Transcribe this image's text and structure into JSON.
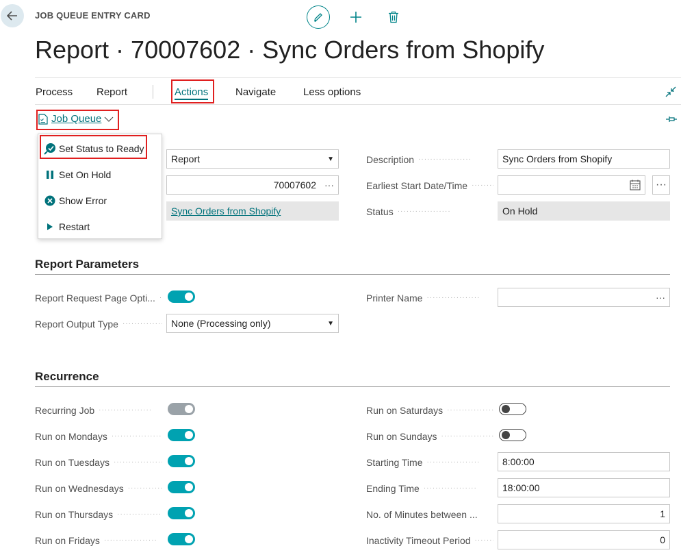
{
  "header": {
    "card_label": "JOB QUEUE ENTRY CARD",
    "title": "Report · 70007602 · Sync Orders from Shopify"
  },
  "icons": {
    "back": "arrow-left-icon",
    "edit": "pencil-icon",
    "new": "plus-icon",
    "delete": "trash-icon",
    "collapse": "collapse-arrows-icon",
    "pin": "pin-icon"
  },
  "action_bar": {
    "tabs": [
      "Process",
      "Report",
      "Actions",
      "Navigate",
      "Less options"
    ],
    "active": "Actions"
  },
  "sub_bar": {
    "group_label": "Job Queue"
  },
  "dropdown": {
    "items": [
      "Set Status to Ready",
      "Set On Hold",
      "Show Error",
      "Restart"
    ]
  },
  "general": {
    "object_type": "Report",
    "object_id": "70007602",
    "object_caption": "Sync Orders from Shopify",
    "description_label": "Description",
    "description_value": "Sync Orders from Shopify",
    "earliest_start_label": "Earliest Start Date/Time",
    "earliest_start_value": "",
    "status_label": "Status",
    "status_value": "On Hold",
    "ellipsis": "···"
  },
  "report_parameters": {
    "title": "Report Parameters",
    "request_page_label": "Report Request Page Opti...",
    "request_page_on": true,
    "output_type_label": "Report Output Type",
    "output_type_value": "None (Processing only)",
    "printer_label": "Printer Name",
    "printer_value": "",
    "ellipsis": "···"
  },
  "recurrence": {
    "title": "Recurrence",
    "left": [
      {
        "label": "Recurring Job",
        "state": "disabled"
      },
      {
        "label": "Run on Mondays",
        "state": "on"
      },
      {
        "label": "Run on Tuesdays",
        "state": "on"
      },
      {
        "label": "Run on Wednesdays",
        "state": "on"
      },
      {
        "label": "Run on Thursdays",
        "state": "on"
      },
      {
        "label": "Run on Fridays",
        "state": "on"
      }
    ],
    "saturdays_label": "Run on Saturdays",
    "saturdays_state": "off",
    "sundays_label": "Run on Sundays",
    "sundays_state": "off",
    "starting_time_label": "Starting Time",
    "starting_time_value": "8:00:00",
    "ending_time_label": "Ending Time",
    "ending_time_value": "18:00:00",
    "minutes_between_label": "No. of Minutes between ...",
    "minutes_between_value": "1",
    "inactivity_label": "Inactivity Timeout Period",
    "inactivity_value": "0"
  },
  "colors": {
    "accent": "#00727b",
    "toggle_on": "#00a2b1",
    "highlight_box": "#e01f1f"
  }
}
